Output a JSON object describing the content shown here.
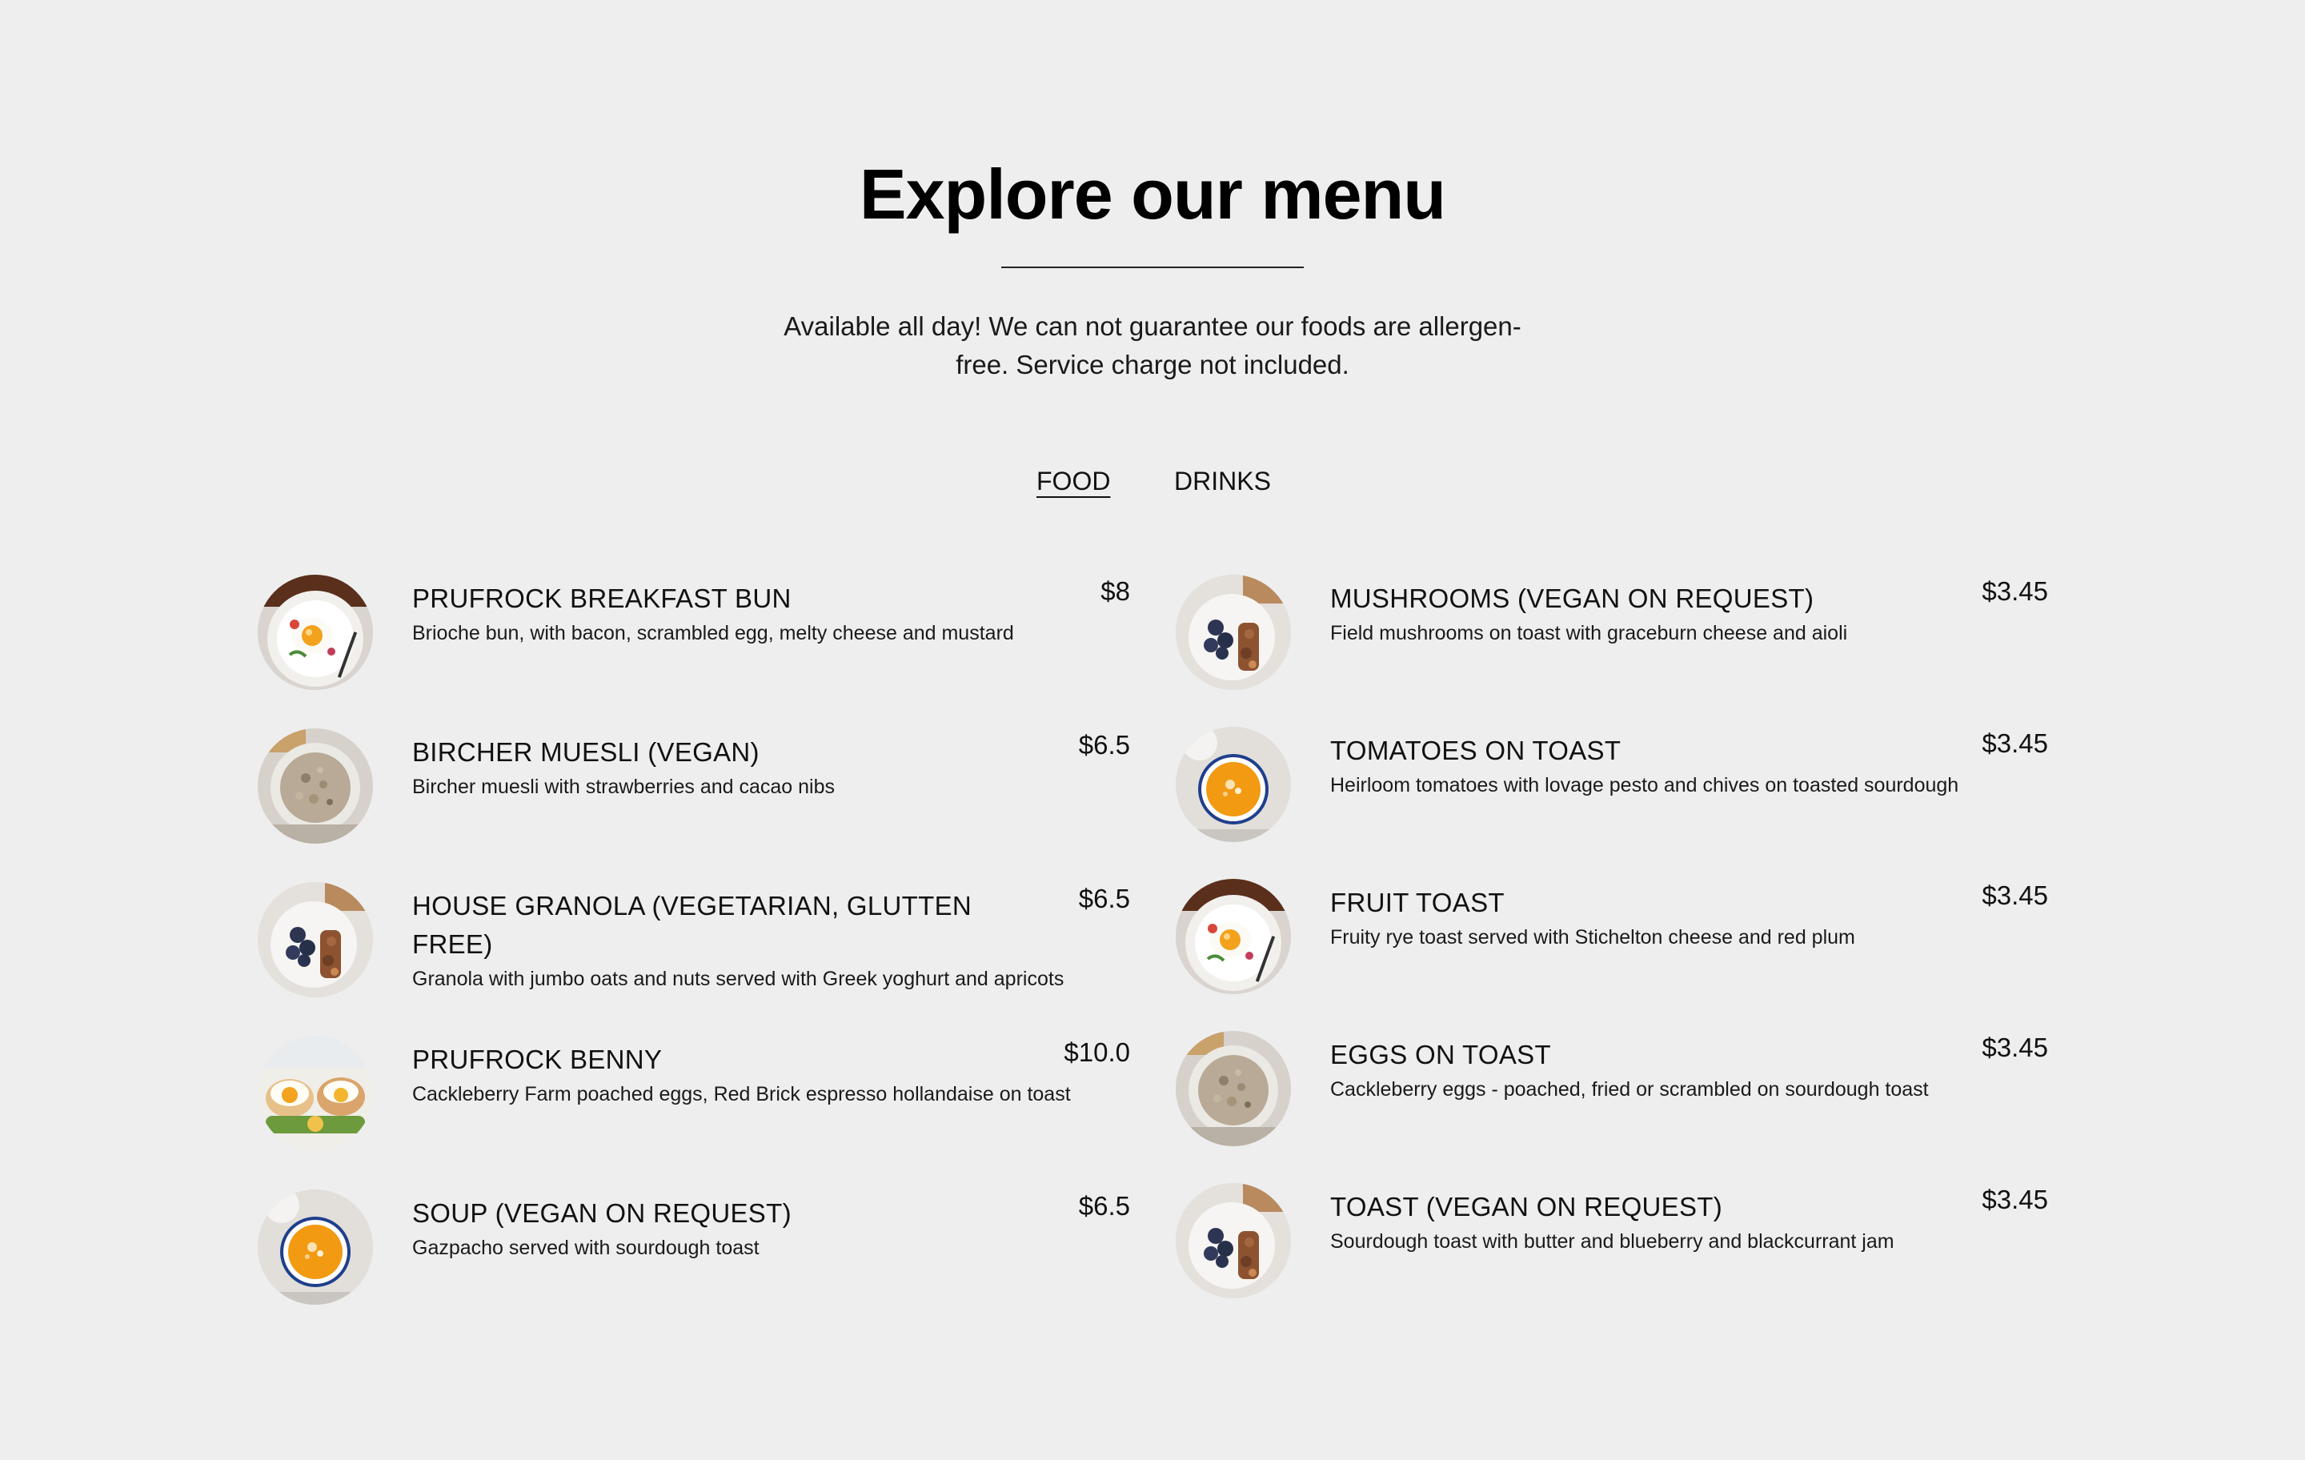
{
  "header": {
    "title": "Explore our menu",
    "intro_line1": "Available all day! We can not guarantee our foods are allergen-",
    "intro_line2": "free. Service charge not included."
  },
  "tabs": [
    {
      "label": "FOOD",
      "active": true
    },
    {
      "label": "DRINKS",
      "active": false
    }
  ],
  "left_items": [
    {
      "name": "PRUFROCK BREAKFAST BUN",
      "description": "Brioche bun, with bacon, scrambled egg, melty cheese and mustard",
      "price": "$8",
      "image": "egg-plate-photo"
    },
    {
      "name": "BIRCHER MUESLI (VEGAN)",
      "description": "Bircher muesli with strawberries and cacao nibs",
      "price": "$6.5",
      "image": "muesli-bowl-photo"
    },
    {
      "name_line1": "HOUSE GRANOLA (VEGETARIAN, GLUTTEN",
      "name_line2": "FREE)",
      "description": "Granola with jumbo oats and nuts served with Greek yoghurt and apricots",
      "price": "$6.5",
      "image": "granola-bowl-photo"
    },
    {
      "name": "PRUFROCK BENNY",
      "description": "Cackleberry Farm poached eggs, Red Brick espresso hollandaise on toast",
      "price": "$10.0",
      "image": "eggs-benedict-photo"
    },
    {
      "name": "SOUP (VEGAN ON REQUEST)",
      "description": "Gazpacho served with sourdough toast",
      "price": "$6.5",
      "image": "soup-bowl-photo"
    }
  ],
  "right_items": [
    {
      "name": "MUSHROOMS (VEGAN ON REQUEST)",
      "description": "Field mushrooms on toast with graceburn cheese and aioli",
      "price": "$3.45",
      "image": "granola-bowl-photo"
    },
    {
      "name": "TOMATOES ON TOAST",
      "description": "Heirloom tomatoes with lovage pesto and chives on toasted sourdough",
      "price": "$3.45",
      "image": "soup-bowl-photo"
    },
    {
      "name": "FRUIT TOAST",
      "description": "Fruity rye toast served with Stichelton cheese and red plum",
      "price": "$3.45",
      "image": "egg-plate-photo"
    },
    {
      "name": "EGGS ON TOAST",
      "description": "Cackleberry eggs - poached, fried or scrambled on sourdough toast",
      "price": "$3.45",
      "image": "muesli-bowl-photo"
    },
    {
      "name": "TOAST (VEGAN ON REQUEST)",
      "description": "Sourdough toast with butter and blueberry and blackcurrant jam",
      "price": "$3.45",
      "image": "granola-bowl-photo"
    }
  ],
  "colors": {
    "background": "#eeeeee",
    "text": "#111111",
    "divider": "#222222"
  }
}
